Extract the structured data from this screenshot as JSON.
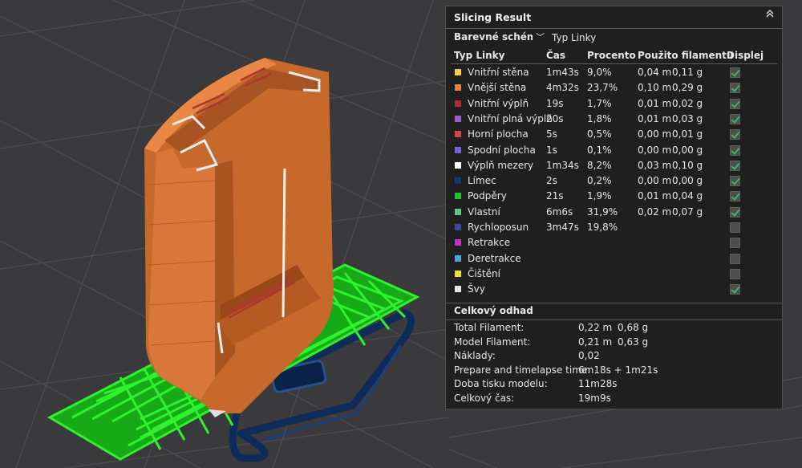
{
  "panel": {
    "title": "Slicing Result",
    "collapse_icon": "chevron-double-up-icon",
    "scheme_label": "Barevné schéma",
    "scheme_value": "Typ Linky",
    "headers": {
      "type": "Typ Linky",
      "time": "Čas",
      "percent": "Procento",
      "filament": "Použito filamentu",
      "display": "Displej"
    },
    "rows": [
      {
        "name": "Vnitřní stěna",
        "color": "#f5cf3d",
        "time": "1m43s",
        "percent": "9,0%",
        "m": "0,04 m",
        "g": "0,11 g",
        "checked": true
      },
      {
        "name": "Vnější stěna",
        "color": "#e8803a",
        "time": "4m32s",
        "percent": "23,7%",
        "m": "0,10 m",
        "g": "0,29 g",
        "checked": true
      },
      {
        "name": "Vnitřní výplň",
        "color": "#b52b2b",
        "time": "19s",
        "percent": "1,7%",
        "m": "0,01 m",
        "g": "0,02 g",
        "checked": true
      },
      {
        "name": "Vnitřní plná výplň",
        "color": "#a05ad0",
        "time": "20s",
        "percent": "1,8%",
        "m": "0,01 m",
        "g": "0,03 g",
        "checked": true
      },
      {
        "name": "Horní plocha",
        "color": "#e0424a",
        "time": "5s",
        "percent": "0,5%",
        "m": "0,00 m",
        "g": "0,01 g",
        "checked": true
      },
      {
        "name": "Spodní plocha",
        "color": "#7562d6",
        "time": "1s",
        "percent": "0,1%",
        "m": "0,00 m",
        "g": "0,00 g",
        "checked": true
      },
      {
        "name": "Výplň mezery",
        "color": "#ffffff",
        "time": "1m34s",
        "percent": "8,2%",
        "m": "0,03 m",
        "g": "0,10 g",
        "checked": true
      },
      {
        "name": "Límec",
        "color": "#0e3a7a",
        "time": "2s",
        "percent": "0,2%",
        "m": "0,00 m",
        "g": "0,00 g",
        "checked": true
      },
      {
        "name": "Podpěry",
        "color": "#22c22a",
        "time": "21s",
        "percent": "1,9%",
        "m": "0,01 m",
        "g": "0,04 g",
        "checked": true
      },
      {
        "name": "Vlastní",
        "color": "#5ec68a",
        "time": "6m6s",
        "percent": "31,9%",
        "m": "0,02 m",
        "g": "0,07 g",
        "checked": true
      },
      {
        "name": "Rychloposun",
        "color": "#3a4aa0",
        "time": "3m47s",
        "percent": "19,8%",
        "m": "",
        "g": "",
        "checked": false
      },
      {
        "name": "Retrakce",
        "color": "#c431c4",
        "time": "",
        "percent": "",
        "m": "",
        "g": "",
        "checked": false
      },
      {
        "name": "Deretrakce",
        "color": "#4aa8d8",
        "time": "",
        "percent": "",
        "m": "",
        "g": "",
        "checked": false
      },
      {
        "name": "Čištění",
        "color": "#f0e020",
        "time": "",
        "percent": "",
        "m": "",
        "g": "",
        "checked": false
      },
      {
        "name": "Švy",
        "color": "#e6e6e6",
        "time": "",
        "percent": "",
        "m": "",
        "g": "",
        "checked": true
      }
    ],
    "summary_title": "Celkový odhad",
    "summary": [
      {
        "label": "Total Filament:",
        "v1": "0,22 m",
        "v2": "0,68 g"
      },
      {
        "label": "Model Filament:",
        "v1": "0,21 m",
        "v2": "0,63 g"
      },
      {
        "label": "Náklady:",
        "v1": "0,02",
        "v2": ""
      },
      {
        "label": "Prepare and timelapse time:",
        "v1": "6m18s + 1m21s",
        "v2": ""
      },
      {
        "label": "Doba tisku modelu:",
        "v1": "11m28s",
        "v2": ""
      },
      {
        "label": "Celkový čas:",
        "v1": "19m9s",
        "v2": ""
      }
    ]
  },
  "colors": {
    "background": "#3a3a3c",
    "grid": "#4a4a4d",
    "model_orange": "#c8692c",
    "support_green": "#1fd21f",
    "skirt_blue": "#0e2c5a"
  }
}
